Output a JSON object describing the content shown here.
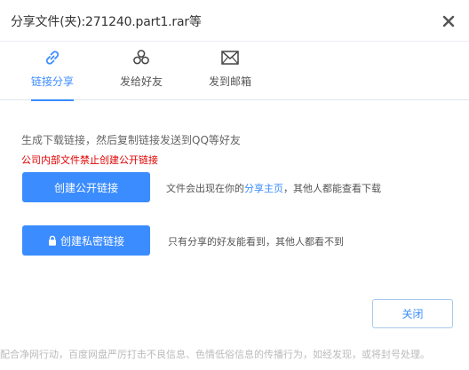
{
  "dialog": {
    "title": "分享文件(夹):271240.part1.rar等"
  },
  "tabs": [
    {
      "label": "链接分享",
      "icon": "link-icon",
      "active": true
    },
    {
      "label": "发给好友",
      "icon": "friends-icon",
      "active": false
    },
    {
      "label": "发到邮箱",
      "icon": "mail-icon",
      "active": false
    }
  ],
  "content": {
    "hint": "生成下载链接，然后复制链接发送到QQ等好友",
    "warning": "公司内部文件禁止创建公开链接",
    "public_button": "创建公开链接",
    "public_desc_before": "文件会出现在你的",
    "public_desc_link": "分享主页",
    "public_desc_after": "，其他人都能查看下载",
    "private_button": "创建私密链接",
    "private_desc": "只有分享的好友能看到，其他人都看不到"
  },
  "actions": {
    "close_label": "关闭"
  },
  "footer": {
    "notice": "配合净网行动，百度网盘严厉打击不良信息、色情低俗信息的传播行为，如经发现，或将封号处理。"
  },
  "colors": {
    "accent": "#3b8cff",
    "warning": "#e00000",
    "text": "#333333",
    "muted": "#bbbbbb"
  }
}
